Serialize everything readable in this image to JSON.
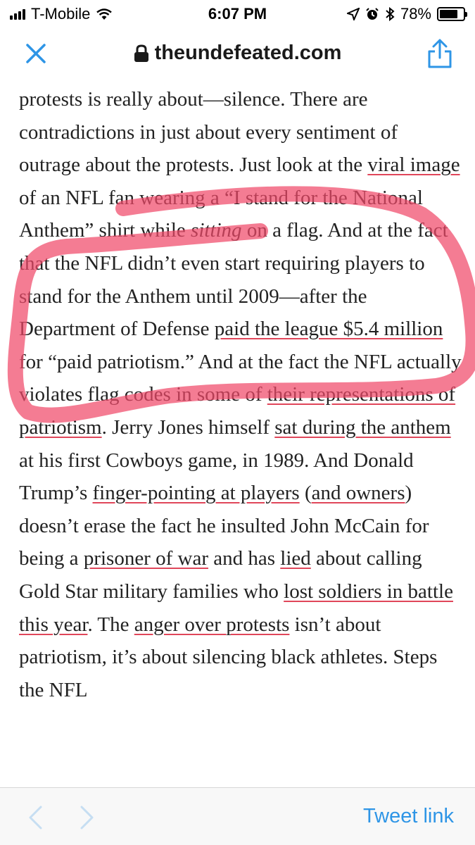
{
  "status_bar": {
    "carrier": "T-Mobile",
    "time": "6:07 PM",
    "battery_percent": "78%",
    "battery_level": 0.78
  },
  "nav_bar": {
    "domain": "theundefeated.com",
    "close_icon": "close-icon",
    "lock_icon": "lock-icon",
    "share_icon": "share-icon"
  },
  "article": {
    "segments": [
      {
        "text": "protests is really about—silence. There are contradictions in just about every sentiment of outrage about the protests. Just look at the "
      },
      {
        "text": "viral image",
        "link": true
      },
      {
        "text": " of an NFL fan wearing a “I stand for the National Anthem” shirt while "
      },
      {
        "text": "sitting",
        "italic": true
      },
      {
        "text": " on a flag. And at the fact that the NFL didn’t even start requiring players to stand for the Anthem until 2009—after the Department of Defense "
      },
      {
        "text": "paid the league $5.4 million",
        "link": true
      },
      {
        "text": " for “paid patriotism.” And at the fact the NFL actually violates flag codes in some of "
      },
      {
        "text": "their representations of patriotism",
        "link": true
      },
      {
        "text": ". Jerry Jones himself "
      },
      {
        "text": "sat during the anthem",
        "link": true
      },
      {
        "text": " at his first Cowboys game, in 1989. And Donald Trump’s "
      },
      {
        "text": "finger-pointing at players",
        "link": true
      },
      {
        "text": " ("
      },
      {
        "text": "and owners",
        "link": true
      },
      {
        "text": ") doesn’t erase the fact he insulted John McCain for being a "
      },
      {
        "text": "prisoner of war",
        "link": true
      },
      {
        "text": " and has "
      },
      {
        "text": "lied",
        "link": true
      },
      {
        "text": " about calling Gold Star military families who "
      },
      {
        "text": "lost soldiers in battle this year",
        "link": true
      },
      {
        "text": ". The "
      },
      {
        "text": "anger over protests",
        "link": true
      },
      {
        "text": " isn’t about patriotism, it’s about silencing black athletes. Steps the NFL"
      }
    ],
    "link_underline_color": "#e0465a",
    "highlight_color": "#f04a6a"
  },
  "toolbar": {
    "back_icon": "chevron-left-icon",
    "forward_icon": "chevron-right-icon",
    "tweet_link_label": "Tweet link",
    "accent_color": "#2e95e6"
  }
}
